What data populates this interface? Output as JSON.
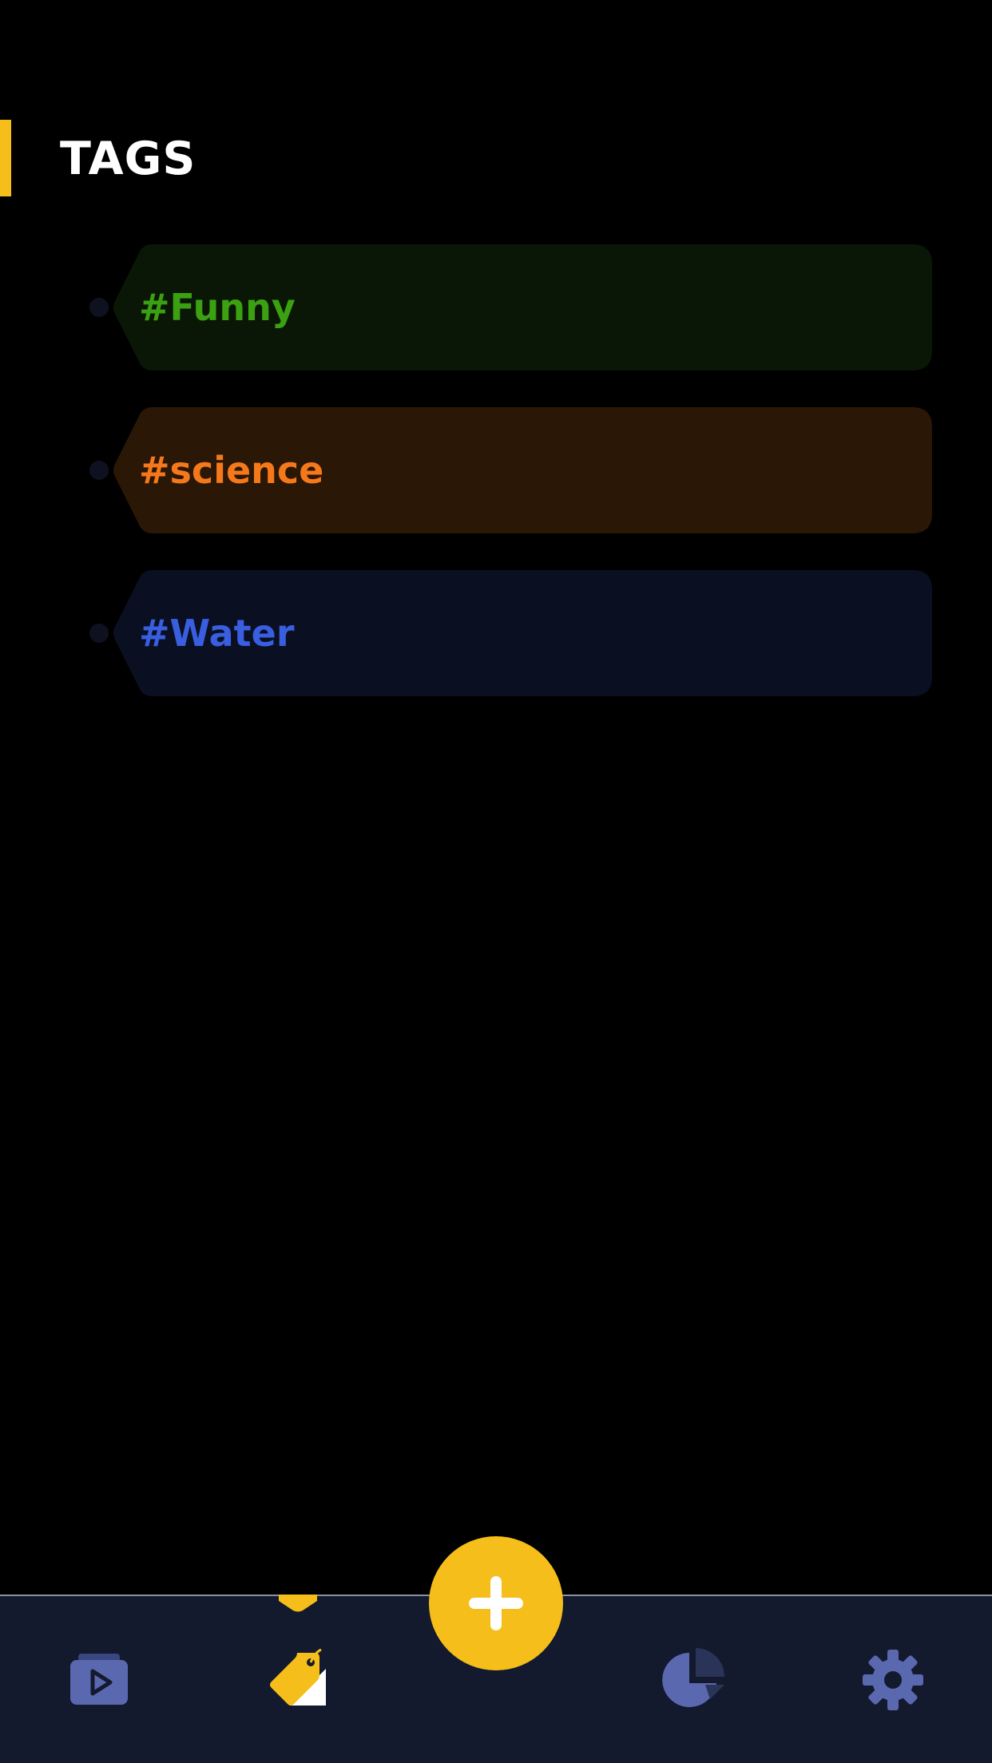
{
  "header": {
    "title": "TAGS",
    "accent_color": "#F5BE1A"
  },
  "tags": [
    {
      "label": "#Funny",
      "text_color": "#3BA112",
      "bg_color": "#0A1706"
    },
    {
      "label": "#science",
      "text_color": "#F5781A",
      "bg_color": "#2A1706"
    },
    {
      "label": "#Water",
      "text_color": "#3A5EE0",
      "bg_color": "#0A1022"
    }
  ],
  "bottom_nav": {
    "items": [
      {
        "icon": "video-folder-icon",
        "active": false
      },
      {
        "icon": "tag-icon",
        "active": true
      },
      {
        "icon": "pie-chart-icon",
        "active": false
      },
      {
        "icon": "gear-icon",
        "active": false
      }
    ],
    "fab_icon": "plus-icon",
    "background": "#131A2E",
    "icon_color": "#5A68B0",
    "active_color": "#F5BE1A"
  }
}
